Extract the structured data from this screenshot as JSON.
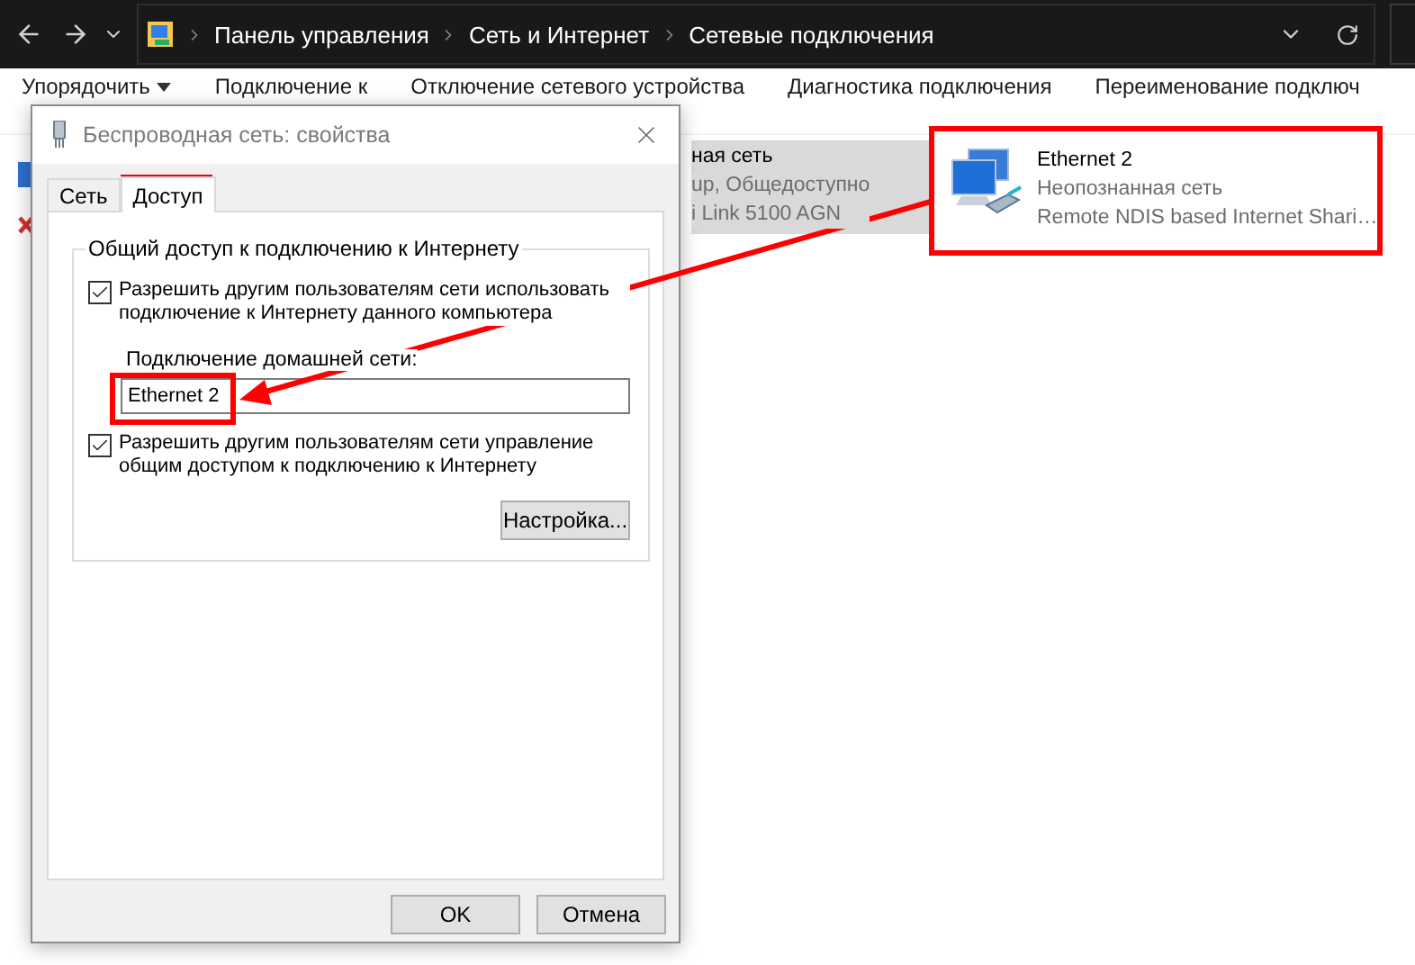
{
  "address_bar": {
    "path": [
      "Панель управления",
      "Сеть и Интернет",
      "Сетевые подключения"
    ]
  },
  "toolbar": [
    {
      "label": "Упорядочить",
      "menu": true
    },
    {
      "label": "Подключение к",
      "menu": false
    },
    {
      "label": "Отключение сетевого устройства",
      "menu": false
    },
    {
      "label": "Диагностика подключения",
      "menu": false
    },
    {
      "label": "Переименование подключ",
      "menu": false
    }
  ],
  "connections": [
    {
      "name": "ная сеть",
      "status": "up, Общедоступно",
      "adapter": "i Link 5100 AGN",
      "selected": true
    },
    {
      "name": "Ethernet 2",
      "status": "Неопознанная сеть",
      "adapter": "Remote NDIS based Internet Shari…",
      "selected": false
    }
  ],
  "dialog": {
    "title": "Беспроводная сеть: свойства",
    "tabs": [
      {
        "label": "Сеть",
        "selected": false
      },
      {
        "label": "Доступ",
        "selected": true
      }
    ],
    "group_title": "Общий доступ к подключению к Интернету",
    "options": [
      {
        "label": "Разрешить другим пользователям сети использовать подключение к Интернету данного компьютера",
        "checked": true
      },
      {
        "label": "Разрешить другим пользователям сети управление общим доступом к подключению к Интернету",
        "checked": true
      }
    ],
    "home_network_label": "Подключение домашней сети:",
    "home_network_value": "Ethernet 2",
    "settings_button": "Настройка...",
    "buttons": [
      "OK",
      "Отмена"
    ]
  }
}
